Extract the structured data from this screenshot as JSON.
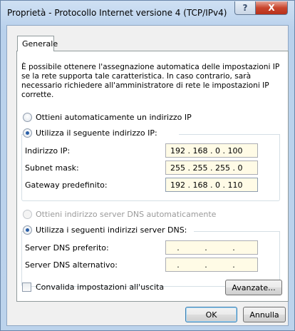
{
  "window": {
    "title": "Proprietà - Protocollo Internet versione 4 (TCP/IPv4)",
    "help_label": "?",
    "close_label": "X"
  },
  "tab": {
    "label": "Generale"
  },
  "description": "È possibile ottenere l'assegnazione automatica delle impostazioni IP se la rete supporta tale caratteristica. In caso contrario, sarà necessario richiedere all'amministratore di rete le impostazioni IP corrette.",
  "ip_options": {
    "auto": {
      "label": "Ottieni automaticamente un indirizzo IP",
      "selected": false
    },
    "manual": {
      "label": "Utilizza il seguente indirizzo IP:",
      "selected": true
    }
  },
  "ip_fields": {
    "address": {
      "label": "Indirizzo IP:",
      "value": "192 . 168 . 0 . 100"
    },
    "subnet": {
      "label": "Subnet mask:",
      "value": "255 . 255 . 255 . 0"
    },
    "gateway": {
      "label": "Gateway predefinito:",
      "value": "192 . 168 . 0 . 110"
    }
  },
  "dns_options": {
    "auto": {
      "label": "Ottieni indirizzo server DNS automaticamente",
      "selected": false,
      "enabled": false
    },
    "manual": {
      "label": "Utilizza i seguenti indirizzi server DNS:",
      "selected": true
    }
  },
  "dns_fields": {
    "preferred": {
      "label": "Server DNS preferito:",
      "value": ". . ."
    },
    "alternate": {
      "label": "Server DNS alternativo:",
      "value": ". . ."
    }
  },
  "validate": {
    "label": "Convalida impostazioni all'uscita",
    "checked": false
  },
  "buttons": {
    "advanced": "Avanzate...",
    "ok": "OK",
    "cancel": "Annulla"
  }
}
